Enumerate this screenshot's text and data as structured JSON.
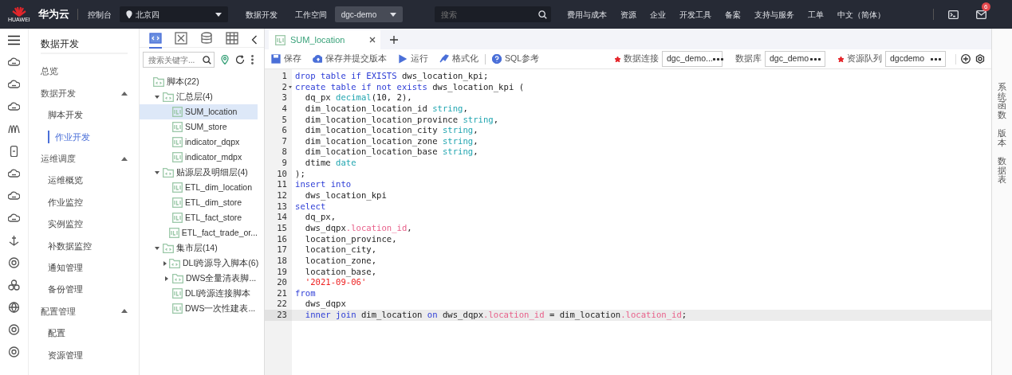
{
  "topbar": {
    "logo_mark": "HUAWEI",
    "brand": "华为云",
    "console": "控制台",
    "region": "北京四",
    "service": "数据开发",
    "workspace_label": "工作空间",
    "workspace": "dgc-demo",
    "search": {
      "placeholder": "搜索"
    },
    "menu": [
      "费用与成本",
      "资源",
      "企业",
      "开发工具",
      "备案",
      "支持与服务",
      "工单",
      "中文（简体）"
    ],
    "mail_badge": "6"
  },
  "nav": {
    "title": "数据开发",
    "items": [
      {
        "label": "总览",
        "kind": "link"
      },
      {
        "label": "数据开发",
        "kind": "group",
        "expanded": true,
        "children": [
          {
            "label": "脚本开发",
            "selected": false
          },
          {
            "label": "作业开发",
            "selected": true
          }
        ]
      },
      {
        "label": "运维调度",
        "kind": "group",
        "expanded": true,
        "children": [
          {
            "label": "运维概览",
            "selected": false
          },
          {
            "label": "作业监控",
            "selected": false
          },
          {
            "label": "实例监控",
            "selected": false
          },
          {
            "label": "补数据监控",
            "selected": false
          },
          {
            "label": "通知管理",
            "selected": false
          },
          {
            "label": "备份管理",
            "selected": false
          }
        ]
      },
      {
        "label": "配置管理",
        "kind": "group",
        "expanded": true,
        "children": [
          {
            "label": "配置",
            "selected": false
          },
          {
            "label": "资源管理",
            "selected": false
          }
        ]
      }
    ]
  },
  "tree_panel": {
    "tabs": [
      {
        "kind": "script",
        "selected": true
      },
      {
        "kind": "job",
        "selected": false
      },
      {
        "kind": "database",
        "selected": false
      },
      {
        "kind": "table",
        "selected": false
      }
    ],
    "search": {
      "placeholder": "搜索关键字..."
    },
    "tree": [
      {
        "label": "脚本(22)",
        "kind": "folder",
        "selected": false,
        "children": [
          {
            "label": "汇总层(4)",
            "kind": "folder",
            "expanded": true,
            "selected": false,
            "children": [
              {
                "label": "SUM_location",
                "kind": "file",
                "selected": true
              },
              {
                "label": "SUM_store",
                "kind": "file",
                "selected": false
              },
              {
                "label": "indicator_dqpx",
                "kind": "file",
                "selected": false
              },
              {
                "label": "indicator_mdpx",
                "kind": "file",
                "selected": false
              }
            ]
          },
          {
            "label": "贴源层及明细层(4)",
            "kind": "folder",
            "expanded": true,
            "selected": false,
            "children": [
              {
                "label": "ETL_dim_location",
                "kind": "file",
                "selected": false
              },
              {
                "label": "ETL_dim_store",
                "kind": "file",
                "selected": false
              },
              {
                "label": "ETL_fact_store",
                "kind": "file",
                "selected": false
              },
              {
                "label": "ETL_fact_trade_or...",
                "kind": "file",
                "selected": false
              }
            ]
          },
          {
            "label": "集市层(14)",
            "kind": "folder",
            "expanded": true,
            "selected": false,
            "children": [
              {
                "label": "DLI跨源导入脚本(6)",
                "kind": "folder",
                "expanded": false,
                "selected": false
              },
              {
                "label": "DWS全量清表脚...",
                "kind": "folder",
                "expanded": false,
                "selected": false
              },
              {
                "label": "DLI跨源连接脚本",
                "kind": "file",
                "selected": false
              },
              {
                "label": "DWS一次性建表...",
                "kind": "file",
                "selected": false
              }
            ]
          }
        ]
      }
    ]
  },
  "editor": {
    "tabs": [
      {
        "label": "SUM_location",
        "selected": true
      }
    ],
    "toolbar": [
      {
        "label": "保存",
        "kind": "save"
      },
      {
        "label": "保存并提交版本",
        "kind": "upload"
      },
      {
        "label": "运行",
        "kind": "run"
      },
      {
        "label": "格式化",
        "kind": "format"
      },
      {
        "label": "SQL参考",
        "kind": "help"
      }
    ],
    "fields": [
      {
        "label": "数据连接",
        "value": "dgc_demo...",
        "required": true
      },
      {
        "label": "数据库",
        "value": "dgc_demo",
        "required": false
      },
      {
        "label": "资源队列",
        "value": "dgcdemo",
        "required": true
      }
    ],
    "lines": [
      {
        "n": "1",
        "tokens": [
          {
            "t": "drop table if EXISTS",
            "kind": "kw"
          },
          {
            "t": " dws_location_kpi;",
            "kind": "plain"
          }
        ]
      },
      {
        "n": "2",
        "foldable": true,
        "tokens": [
          {
            "t": "create table if not exists",
            "kind": "kw"
          },
          {
            "t": " dws_location_kpi (",
            "kind": "plain"
          }
        ]
      },
      {
        "n": "3",
        "tokens": [
          {
            "t": "  dq_px ",
            "kind": "plain"
          },
          {
            "t": "decimal",
            "kind": "type"
          },
          {
            "t": "(10, 2),",
            "kind": "plain"
          }
        ]
      },
      {
        "n": "4",
        "tokens": [
          {
            "t": "  dim_location_location_id ",
            "kind": "plain"
          },
          {
            "t": "string",
            "kind": "type"
          },
          {
            "t": ",",
            "kind": "plain"
          }
        ]
      },
      {
        "n": "5",
        "tokens": [
          {
            "t": "  dim_location_location_province ",
            "kind": "plain"
          },
          {
            "t": "string",
            "kind": "type"
          },
          {
            "t": ",",
            "kind": "plain"
          }
        ]
      },
      {
        "n": "6",
        "tokens": [
          {
            "t": "  dim_location_location_city ",
            "kind": "plain"
          },
          {
            "t": "string",
            "kind": "type"
          },
          {
            "t": ",",
            "kind": "plain"
          }
        ]
      },
      {
        "n": "7",
        "tokens": [
          {
            "t": "  dim_location_location_zone ",
            "kind": "plain"
          },
          {
            "t": "string",
            "kind": "type"
          },
          {
            "t": ",",
            "kind": "plain"
          }
        ]
      },
      {
        "n": "8",
        "tokens": [
          {
            "t": "  dim_location_location_base ",
            "kind": "plain"
          },
          {
            "t": "string",
            "kind": "type"
          },
          {
            "t": ",",
            "kind": "plain"
          }
        ]
      },
      {
        "n": "9",
        "tokens": [
          {
            "t": "  dtime ",
            "kind": "plain"
          },
          {
            "t": "date",
            "kind": "type"
          }
        ]
      },
      {
        "n": "10",
        "tokens": [
          {
            "t": ");",
            "kind": "plain"
          }
        ]
      },
      {
        "n": "11",
        "tokens": [
          {
            "t": "insert into",
            "kind": "kw"
          }
        ]
      },
      {
        "n": "12",
        "tokens": [
          {
            "t": "  dws_location_kpi",
            "kind": "plain"
          }
        ]
      },
      {
        "n": "13",
        "tokens": [
          {
            "t": "select",
            "kind": "kw"
          }
        ]
      },
      {
        "n": "14",
        "tokens": [
          {
            "t": "  dq_px,",
            "kind": "plain"
          }
        ]
      },
      {
        "n": "15",
        "tokens": [
          {
            "t": "  dws_dqpx",
            "kind": "plain"
          },
          {
            "t": ".location_id",
            "kind": "prop"
          },
          {
            "t": ",",
            "kind": "plain"
          }
        ]
      },
      {
        "n": "16",
        "tokens": [
          {
            "t": "  location_province,",
            "kind": "plain"
          }
        ]
      },
      {
        "n": "17",
        "tokens": [
          {
            "t": "  location_city,",
            "kind": "plain"
          }
        ]
      },
      {
        "n": "18",
        "tokens": [
          {
            "t": "  location_zone,",
            "kind": "plain"
          }
        ]
      },
      {
        "n": "19",
        "tokens": [
          {
            "t": "  location_base,",
            "kind": "plain"
          }
        ]
      },
      {
        "n": "20",
        "tokens": [
          {
            "t": "  '2021-09-06'",
            "kind": "str"
          }
        ]
      },
      {
        "n": "21",
        "tokens": [
          {
            "t": "from",
            "kind": "kw"
          }
        ]
      },
      {
        "n": "22",
        "tokens": [
          {
            "t": "  dws_dqpx",
            "kind": "plain"
          }
        ]
      },
      {
        "n": "23",
        "selected": true,
        "tokens": [
          {
            "t": "  inner join",
            "kind": "kw"
          },
          {
            "t": " dim_location ",
            "kind": "plain"
          },
          {
            "t": "on",
            "kind": "kw"
          },
          {
            "t": " dws_dqpx",
            "kind": "plain"
          },
          {
            "t": ".location_id",
            "kind": "prop"
          },
          {
            "t": " = dim_location",
            "kind": "plain"
          },
          {
            "t": ".location_id",
            "kind": "prop"
          },
          {
            "t": ";",
            "kind": "plain"
          }
        ]
      }
    ]
  },
  "right_rail": [
    "系统函数",
    "版本",
    "数据表"
  ]
}
